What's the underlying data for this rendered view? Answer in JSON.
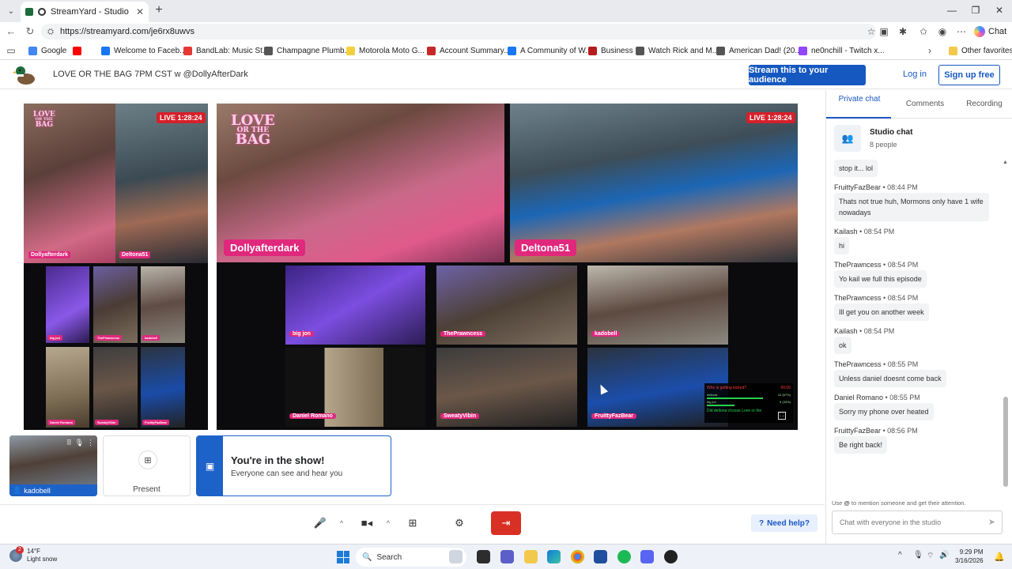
{
  "browser": {
    "tab_title": "StreamYard - Studio",
    "url": "https://streamyard.com/je6rx8uwvs",
    "chat_label": "Chat",
    "bookmarks": [
      {
        "label": "Google",
        "color": "#4285f4"
      },
      {
        "label": "",
        "color": "#ff0000"
      },
      {
        "label": "Welcome to Faceb...",
        "color": "#1877f2"
      },
      {
        "label": "BandLab: Music St...",
        "color": "#e53935"
      },
      {
        "label": "Champagne Plumb...",
        "color": "#555555"
      },
      {
        "label": "Motorola Moto G...",
        "color": "#f4d03f"
      },
      {
        "label": "Account Summary...",
        "color": "#c62828"
      },
      {
        "label": "A Community of W...",
        "color": "#1877f2"
      },
      {
        "label": "Business",
        "color": "#b71c1c"
      },
      {
        "label": "Watch Rick and M...",
        "color": "#555555"
      },
      {
        "label": "American Dad! (20...",
        "color": "#555555"
      },
      {
        "label": "ne0nchill - Twitch x...",
        "color": "#9146ff"
      }
    ],
    "other_favorites": "Other favorites"
  },
  "header": {
    "studio_title": "LOVE OR THE BAG 7PM CST w @DollyAfterDark",
    "stream_button": "Stream this to your audience",
    "login": "Log in",
    "signup": "Sign up free"
  },
  "stage": {
    "logo_line1": "LOVE",
    "logo_line2": "OR THE",
    "logo_line3": "BAG",
    "live_timer": "LIVE 1:28:24",
    "main_hosts": [
      "Dollyafterdark",
      "Deltona51"
    ],
    "guests": [
      "big jon",
      "ThePrawncess",
      "kadobell",
      "Daniel Romano",
      "SweatyVibin",
      "FruittyFazBear"
    ],
    "vote_widget": {
      "question": "Who is getting kicked?",
      "timer": "00:00",
      "rows": [
        {
          "name": "deltona",
          "value": "10 (67%)"
        },
        {
          "name": "big jon",
          "value": "5 (33%)"
        }
      ],
      "footer": "Did deltona choose Love or the"
    }
  },
  "tray": {
    "self_name": "kadobell",
    "present_label": "Present",
    "show_title": "You're in the show!",
    "show_subtitle": "Everyone can see and hear you"
  },
  "controls": {
    "need_help": "Need help?"
  },
  "sidebar": {
    "tabs": [
      "Private chat",
      "Comments",
      "Recording"
    ],
    "studio_chat_title": "Studio chat",
    "studio_chat_count": "8 people",
    "messages": [
      {
        "author": "",
        "time": "",
        "text": "stop it... lol"
      },
      {
        "author": "FruittyFazBear",
        "time": "08:44 PM",
        "text": "Thats not true huh, Mormons only have 1 wife nowadays"
      },
      {
        "author": "Kailash",
        "time": "08:54 PM",
        "text": "hi"
      },
      {
        "author": "ThePrawncess",
        "time": "08:54 PM",
        "text": "Yo kail we full this episode"
      },
      {
        "author": "ThePrawncess",
        "time": "08:54 PM",
        "text": "Ill get you on another week"
      },
      {
        "author": "Kailash",
        "time": "08:54 PM",
        "text": "ok"
      },
      {
        "author": "ThePrawncess",
        "time": "08:55 PM",
        "text": "Unless daniel doesnt come back"
      },
      {
        "author": "Daniel Romano",
        "time": "08:55 PM",
        "text": "Sorry my phone over heated"
      },
      {
        "author": "FruittyFazBear",
        "time": "08:56 PM",
        "text": "Be right back!"
      }
    ],
    "hint_prefix": "Use",
    "hint_at": "@",
    "hint_suffix": "to mention someone and get their attention.",
    "input_placeholder": "Chat with everyone in the studio"
  },
  "taskbar": {
    "weather_temp": "14°F",
    "weather_desc": "Light snow",
    "weather_badge": "2",
    "search_label": "Search",
    "time": "9:29 PM",
    "date": "3/16/2026"
  }
}
